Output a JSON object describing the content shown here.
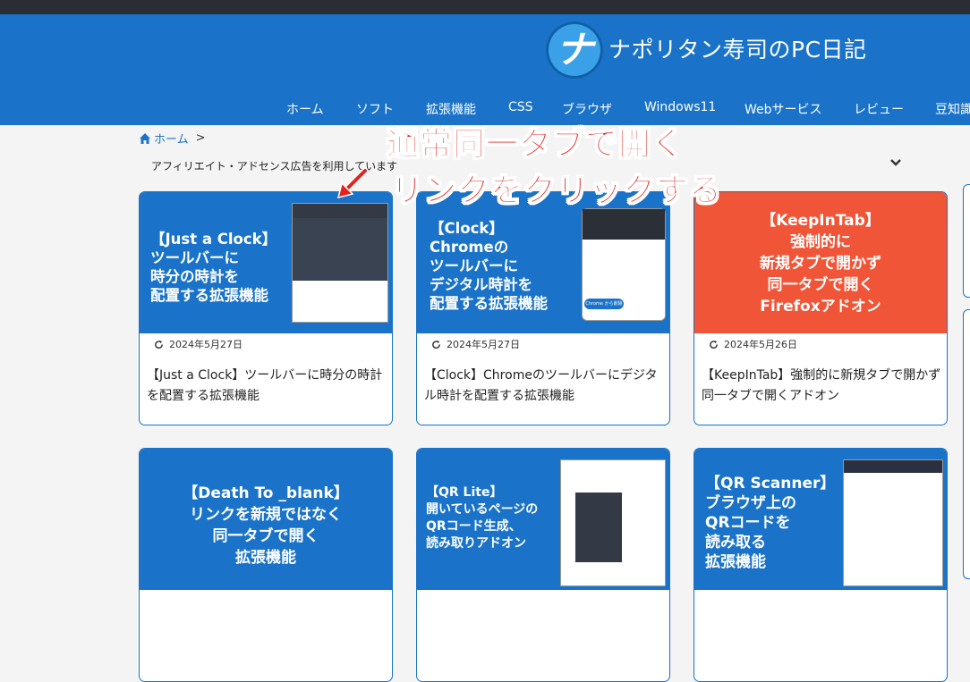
{
  "site": {
    "logo_glyph": "ナ",
    "title": "ナポリタン寿司のPC日記"
  },
  "nav": [
    {
      "label": "ホーム"
    },
    {
      "label": "ソフト"
    },
    {
      "label": "拡張機能"
    },
    {
      "label": "CSS"
    },
    {
      "label": "ブラウザ"
    },
    {
      "label": "Windows11"
    },
    {
      "label": "Webサービス"
    },
    {
      "label": "レビュー"
    },
    {
      "label": "豆知識"
    }
  ],
  "breadcrumb": {
    "home": "ホーム",
    "sep": ">"
  },
  "ad_notice": "アフィリエイト・アドセンス広告を利用しています",
  "annotation": {
    "line1": "通常同一タブで開く",
    "line2": "リンクをクリックする"
  },
  "cards": [
    {
      "thumb": "【Just a Clock】\nツールバーに\n時分の時計を\n配置する拡張機能",
      "date": "2024年5月27日",
      "title": "【Just a Clock】ツールバーに時分の時計を配置する拡張機能"
    },
    {
      "thumb": "【Clock】\nChromeの\nツールバーに\nデジタル時計を\n配置する拡張機能",
      "date": "2024年5月27日",
      "title": "【Clock】Chromeのツールバーにデジタル時計を配置する拡張機能",
      "popup": "Chrome から削除"
    },
    {
      "thumb": "【KeepInTab】\n強制的に\n新規タブで開かず\n同一タブで開く\nFirefoxアドオン",
      "date": "2024年5月26日",
      "title": "【KeepInTab】強制的に新規タブで開かず同一タブで開くアドオン"
    },
    {
      "thumb": "【Death To _blank】\nリンクを新規ではなく\n同一タブで開く\n拡張機能"
    },
    {
      "thumb": "【QR Lite】\n開いているページの\nQRコード生成、\n読み取りアドオン"
    },
    {
      "thumb": "【QR Scanner】\nブラウザ上の\nQRコードを\n読み取る\n拡張機能"
    }
  ],
  "colors": {
    "brand": "#1a73c8",
    "annotation": "#e3221c",
    "keepintab": "#f05537"
  }
}
